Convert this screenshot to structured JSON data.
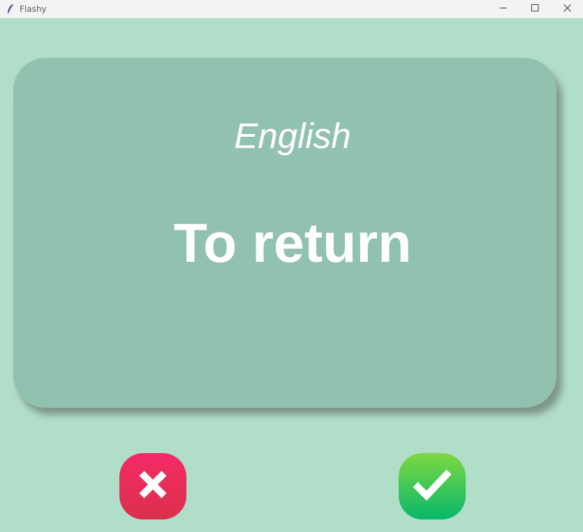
{
  "window": {
    "title": "Flashy",
    "app_icon": "feather-icon",
    "controls": [
      "minimize-icon",
      "maximize-icon",
      "close-icon"
    ]
  },
  "card": {
    "language": "English",
    "word": "To return",
    "color": "#91c2af"
  },
  "background_color": "#b1dec8",
  "buttons": {
    "wrong": {
      "icon": "x-mark-icon",
      "color": "#e52d55"
    },
    "right": {
      "icon": "check-mark-icon",
      "color": "#2fc65a"
    }
  }
}
